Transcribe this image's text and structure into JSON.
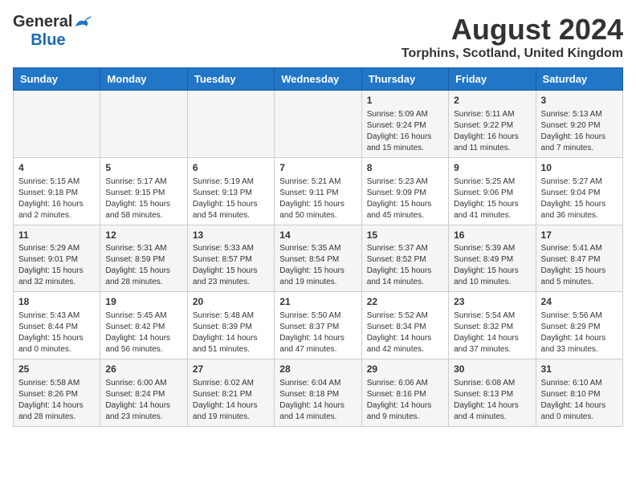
{
  "logo": {
    "general": "General",
    "blue": "Blue"
  },
  "header": {
    "title": "August 2024",
    "subtitle": "Torphins, Scotland, United Kingdom"
  },
  "days_of_week": [
    "Sunday",
    "Monday",
    "Tuesday",
    "Wednesday",
    "Thursday",
    "Friday",
    "Saturday"
  ],
  "weeks": [
    [
      {
        "day": "",
        "info": ""
      },
      {
        "day": "",
        "info": ""
      },
      {
        "day": "",
        "info": ""
      },
      {
        "day": "",
        "info": ""
      },
      {
        "day": "1",
        "info": "Sunrise: 5:09 AM\nSunset: 9:24 PM\nDaylight: 16 hours and 15 minutes."
      },
      {
        "day": "2",
        "info": "Sunrise: 5:11 AM\nSunset: 9:22 PM\nDaylight: 16 hours and 11 minutes."
      },
      {
        "day": "3",
        "info": "Sunrise: 5:13 AM\nSunset: 9:20 PM\nDaylight: 16 hours and 7 minutes."
      }
    ],
    [
      {
        "day": "4",
        "info": "Sunrise: 5:15 AM\nSunset: 9:18 PM\nDaylight: 16 hours and 2 minutes."
      },
      {
        "day": "5",
        "info": "Sunrise: 5:17 AM\nSunset: 9:15 PM\nDaylight: 15 hours and 58 minutes."
      },
      {
        "day": "6",
        "info": "Sunrise: 5:19 AM\nSunset: 9:13 PM\nDaylight: 15 hours and 54 minutes."
      },
      {
        "day": "7",
        "info": "Sunrise: 5:21 AM\nSunset: 9:11 PM\nDaylight: 15 hours and 50 minutes."
      },
      {
        "day": "8",
        "info": "Sunrise: 5:23 AM\nSunset: 9:09 PM\nDaylight: 15 hours and 45 minutes."
      },
      {
        "day": "9",
        "info": "Sunrise: 5:25 AM\nSunset: 9:06 PM\nDaylight: 15 hours and 41 minutes."
      },
      {
        "day": "10",
        "info": "Sunrise: 5:27 AM\nSunset: 9:04 PM\nDaylight: 15 hours and 36 minutes."
      }
    ],
    [
      {
        "day": "11",
        "info": "Sunrise: 5:29 AM\nSunset: 9:01 PM\nDaylight: 15 hours and 32 minutes."
      },
      {
        "day": "12",
        "info": "Sunrise: 5:31 AM\nSunset: 8:59 PM\nDaylight: 15 hours and 28 minutes."
      },
      {
        "day": "13",
        "info": "Sunrise: 5:33 AM\nSunset: 8:57 PM\nDaylight: 15 hours and 23 minutes."
      },
      {
        "day": "14",
        "info": "Sunrise: 5:35 AM\nSunset: 8:54 PM\nDaylight: 15 hours and 19 minutes."
      },
      {
        "day": "15",
        "info": "Sunrise: 5:37 AM\nSunset: 8:52 PM\nDaylight: 15 hours and 14 minutes."
      },
      {
        "day": "16",
        "info": "Sunrise: 5:39 AM\nSunset: 8:49 PM\nDaylight: 15 hours and 10 minutes."
      },
      {
        "day": "17",
        "info": "Sunrise: 5:41 AM\nSunset: 8:47 PM\nDaylight: 15 hours and 5 minutes."
      }
    ],
    [
      {
        "day": "18",
        "info": "Sunrise: 5:43 AM\nSunset: 8:44 PM\nDaylight: 15 hours and 0 minutes."
      },
      {
        "day": "19",
        "info": "Sunrise: 5:45 AM\nSunset: 8:42 PM\nDaylight: 14 hours and 56 minutes."
      },
      {
        "day": "20",
        "info": "Sunrise: 5:48 AM\nSunset: 8:39 PM\nDaylight: 14 hours and 51 minutes."
      },
      {
        "day": "21",
        "info": "Sunrise: 5:50 AM\nSunset: 8:37 PM\nDaylight: 14 hours and 47 minutes."
      },
      {
        "day": "22",
        "info": "Sunrise: 5:52 AM\nSunset: 8:34 PM\nDaylight: 14 hours and 42 minutes."
      },
      {
        "day": "23",
        "info": "Sunrise: 5:54 AM\nSunset: 8:32 PM\nDaylight: 14 hours and 37 minutes."
      },
      {
        "day": "24",
        "info": "Sunrise: 5:56 AM\nSunset: 8:29 PM\nDaylight: 14 hours and 33 minutes."
      }
    ],
    [
      {
        "day": "25",
        "info": "Sunrise: 5:58 AM\nSunset: 8:26 PM\nDaylight: 14 hours and 28 minutes."
      },
      {
        "day": "26",
        "info": "Sunrise: 6:00 AM\nSunset: 8:24 PM\nDaylight: 14 hours and 23 minutes."
      },
      {
        "day": "27",
        "info": "Sunrise: 6:02 AM\nSunset: 8:21 PM\nDaylight: 14 hours and 19 minutes."
      },
      {
        "day": "28",
        "info": "Sunrise: 6:04 AM\nSunset: 8:18 PM\nDaylight: 14 hours and 14 minutes."
      },
      {
        "day": "29",
        "info": "Sunrise: 6:06 AM\nSunset: 8:16 PM\nDaylight: 14 hours and 9 minutes."
      },
      {
        "day": "30",
        "info": "Sunrise: 6:08 AM\nSunset: 8:13 PM\nDaylight: 14 hours and 4 minutes."
      },
      {
        "day": "31",
        "info": "Sunrise: 6:10 AM\nSunset: 8:10 PM\nDaylight: 14 hours and 0 minutes."
      }
    ]
  ]
}
